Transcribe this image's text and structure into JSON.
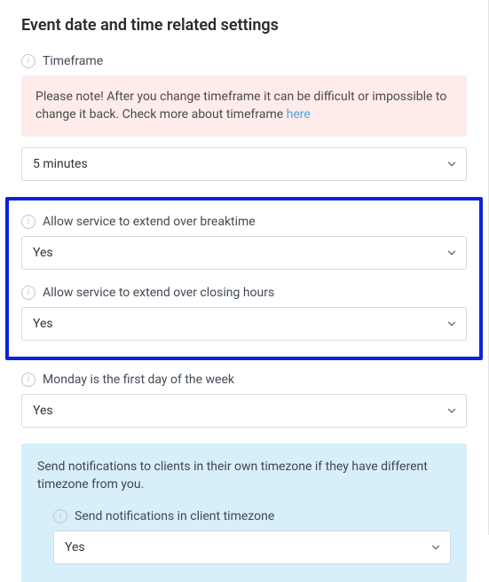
{
  "section": {
    "title": "Event date and time related settings",
    "timeframe": {
      "label": "Timeframe",
      "warning_text": "Please note! After you change timeframe it can be difficult or impossible to change it back. Check more about timeframe ",
      "warning_link": "here",
      "value": "5 minutes"
    },
    "extend_breaktime": {
      "label": "Allow service to extend over breaktime",
      "value": "Yes"
    },
    "extend_closing": {
      "label": "Allow service to extend over closing hours",
      "value": "Yes"
    },
    "monday_first": {
      "label": "Monday is the first day of the week",
      "value": "Yes"
    },
    "client_timezone": {
      "description": "Send notifications to clients in their own timezone if they have different timezone from you.",
      "label": "Send notifications in client timezone",
      "value": "Yes"
    }
  }
}
